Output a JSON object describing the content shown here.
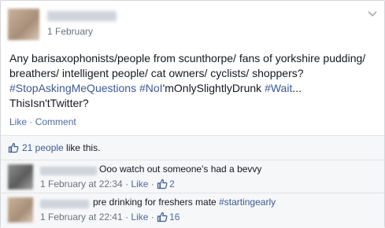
{
  "post": {
    "date": "1 February",
    "text_plain": "Any barisaxophonists/people from scunthorpe/ fans of yorkshire pudding/ breathers/ intelligent people/ cat owners/ cyclists/ shoppers?",
    "hashtag_1": "#StopAskingMeQuestions",
    "hashtag_2": "#NoI",
    "mid_text": "'mOnlySlightlyDrunk",
    "hashtag_3": "#Wait",
    "tail_1": "...",
    "tail_2": "ThisIsn'tTwitter?",
    "actions": {
      "like": "Like",
      "dot": " · ",
      "comment": "Comment"
    }
  },
  "likes": {
    "count_text": "21 people",
    "suffix": " like this."
  },
  "comments": [
    {
      "text": "Ooo watch out someone's had a bevvy",
      "time": "1 February at 22:34",
      "dot": " · ",
      "like": "Like",
      "dot2": " · ",
      "likes": "2"
    },
    {
      "text": "pre drinking for freshers mate",
      "hashtag": "#startingearly",
      "time": "1 February at 22:41",
      "dot": " · ",
      "like": "Like",
      "dot2": " · ",
      "likes": "16"
    }
  ],
  "icons": {
    "chevron": "chevron-down-icon",
    "thumb": "thumbs-up-icon"
  },
  "colors": {
    "link": "#3b5998",
    "meta": "#6a7180",
    "text": "#141823"
  }
}
